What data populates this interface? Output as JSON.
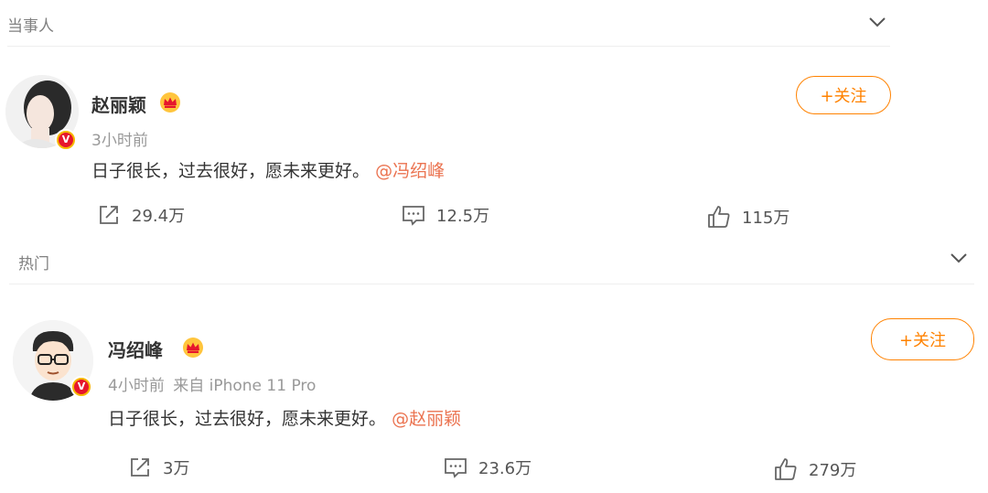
{
  "sections": {
    "top": {
      "title": "当事人"
    },
    "hot": {
      "title": "热门"
    }
  },
  "posts": [
    {
      "author": "赵丽颖",
      "time": "3小时前",
      "source": "",
      "text": "日子很长，过去很好，愿未来更好。",
      "mention": "@冯绍峰",
      "follow_label": "+关注",
      "verified_badge": "V",
      "repost": "29.4万",
      "comment": "12.5万",
      "like": "115万"
    },
    {
      "author": "冯绍峰",
      "time": "4小时前",
      "source": "来自 iPhone 11 Pro",
      "text": "日子很长，过去很好，愿未来更好。",
      "mention": "@赵丽颖",
      "follow_label": "+关注",
      "verified_badge": "V",
      "repost": "3万",
      "comment": "23.6万",
      "like": "279万"
    }
  ],
  "colors": {
    "accent": "#ff8200",
    "mention": "#eb7350",
    "muted": "#999999"
  }
}
